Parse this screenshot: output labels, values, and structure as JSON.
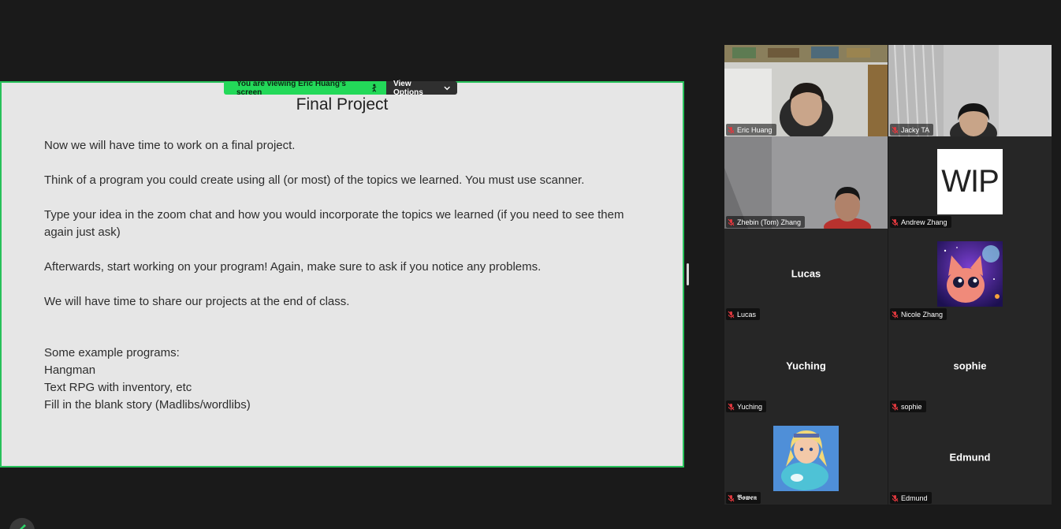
{
  "share_banner": {
    "status_text": "You are viewing  Eric Huang's screen",
    "view_options_label": "View Options"
  },
  "slide": {
    "title": "Final Project",
    "paragraphs": [
      "Now we will have time to work on a final project.",
      "Think of a program you could create using all (or most) of the topics we learned. You must use scanner.",
      "Type your idea in the zoom chat and how you would incorporate the topics we learned (if you need to see them again just ask)",
      "Afterwards, start working on your program! Again, make sure to ask if you notice any problems.",
      "We will have time to share our projects at the end of class."
    ],
    "examples_heading": "Some example programs:",
    "examples": [
      "Hangman",
      "Text RPG with inventory, etc",
      "Fill in the blank story (Madlibs/wordlibs)"
    ]
  },
  "participants": [
    {
      "name": "Eric Huang",
      "muted": true,
      "video": "video",
      "active_speaker": true
    },
    {
      "name": "Jacky TA",
      "muted": true,
      "video": "video"
    },
    {
      "name": "Zhebin (Tom) Zhang",
      "muted": true,
      "video": "video"
    },
    {
      "name": "Andrew Zhang",
      "muted": true,
      "video": "avatar",
      "avatar_text": "WIP"
    },
    {
      "name": "Lucas",
      "muted": true,
      "video": "name",
      "display_name": "Lucas"
    },
    {
      "name": "Nicole Zhang",
      "muted": true,
      "video": "avatar",
      "avatar_icon": "galaxy-cat-avatar-icon"
    },
    {
      "name": "Yuching",
      "muted": true,
      "video": "name",
      "display_name": "Yuching"
    },
    {
      "name": "sophie",
      "muted": true,
      "video": "name",
      "display_name": "sophie"
    },
    {
      "name": "𝕭𝖔𝖜𝖊𝖓",
      "muted": true,
      "video": "avatar",
      "avatar_icon": "cartoon-hero-avatar-icon"
    },
    {
      "name": "Edmund",
      "muted": true,
      "video": "name",
      "display_name": "Edmund"
    }
  ],
  "colors": {
    "share_border": "#27c15a",
    "banner_green": "#23d959",
    "active_speaker": "#d8e34a",
    "mute_red": "#e0383e",
    "background": "#1a1a1a"
  }
}
